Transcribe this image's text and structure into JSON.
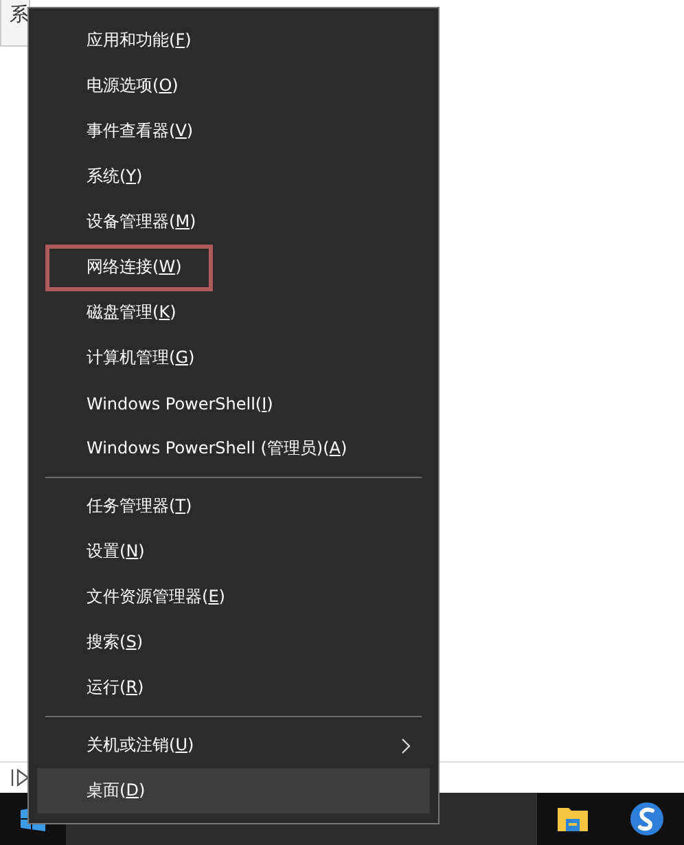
{
  "background_window": {
    "label": "系"
  },
  "context_menu": {
    "items": [
      {
        "kind": "item",
        "prefix": "应用和功能(",
        "access_key": "F",
        "suffix": ")",
        "outlined": false,
        "selected": false,
        "has_submenu": false
      },
      {
        "kind": "item",
        "prefix": "电源选项(",
        "access_key": "O",
        "suffix": ")",
        "outlined": false,
        "selected": false,
        "has_submenu": false
      },
      {
        "kind": "item",
        "prefix": "事件查看器(",
        "access_key": "V",
        "suffix": ")",
        "outlined": false,
        "selected": false,
        "has_submenu": false
      },
      {
        "kind": "item",
        "prefix": "系统(",
        "access_key": "Y",
        "suffix": ")",
        "outlined": false,
        "selected": false,
        "has_submenu": false
      },
      {
        "kind": "item",
        "prefix": "设备管理器(",
        "access_key": "M",
        "suffix": ")",
        "outlined": false,
        "selected": false,
        "has_submenu": false
      },
      {
        "kind": "item",
        "prefix": "网络连接(",
        "access_key": "W",
        "suffix": ")",
        "outlined": true,
        "selected": false,
        "has_submenu": false
      },
      {
        "kind": "item",
        "prefix": "磁盘管理(",
        "access_key": "K",
        "suffix": ")",
        "outlined": false,
        "selected": false,
        "has_submenu": false
      },
      {
        "kind": "item",
        "prefix": "计算机管理(",
        "access_key": "G",
        "suffix": ")",
        "outlined": false,
        "selected": false,
        "has_submenu": false
      },
      {
        "kind": "item",
        "prefix": "Windows PowerShell(",
        "access_key": "I",
        "suffix": ")",
        "outlined": false,
        "selected": false,
        "has_submenu": false
      },
      {
        "kind": "item",
        "prefix": "Windows PowerShell (管理员)(",
        "access_key": "A",
        "suffix": ")",
        "outlined": false,
        "selected": false,
        "has_submenu": false
      },
      {
        "kind": "separator"
      },
      {
        "kind": "item",
        "prefix": "任务管理器(",
        "access_key": "T",
        "suffix": ")",
        "outlined": false,
        "selected": false,
        "has_submenu": false
      },
      {
        "kind": "item",
        "prefix": "设置(",
        "access_key": "N",
        "suffix": ")",
        "outlined": false,
        "selected": false,
        "has_submenu": false
      },
      {
        "kind": "item",
        "prefix": "文件资源管理器(",
        "access_key": "E",
        "suffix": ")",
        "outlined": false,
        "selected": false,
        "has_submenu": false
      },
      {
        "kind": "item",
        "prefix": "搜索(",
        "access_key": "S",
        "suffix": ")",
        "outlined": false,
        "selected": false,
        "has_submenu": false
      },
      {
        "kind": "item",
        "prefix": "运行(",
        "access_key": "R",
        "suffix": ")",
        "outlined": false,
        "selected": false,
        "has_submenu": false
      },
      {
        "kind": "separator"
      },
      {
        "kind": "item",
        "prefix": "关机或注销(",
        "access_key": "U",
        "suffix": ")",
        "outlined": false,
        "selected": false,
        "has_submenu": true
      },
      {
        "kind": "item",
        "prefix": "桌面(",
        "access_key": "D",
        "suffix": ")",
        "outlined": false,
        "selected": true,
        "has_submenu": false
      }
    ]
  }
}
